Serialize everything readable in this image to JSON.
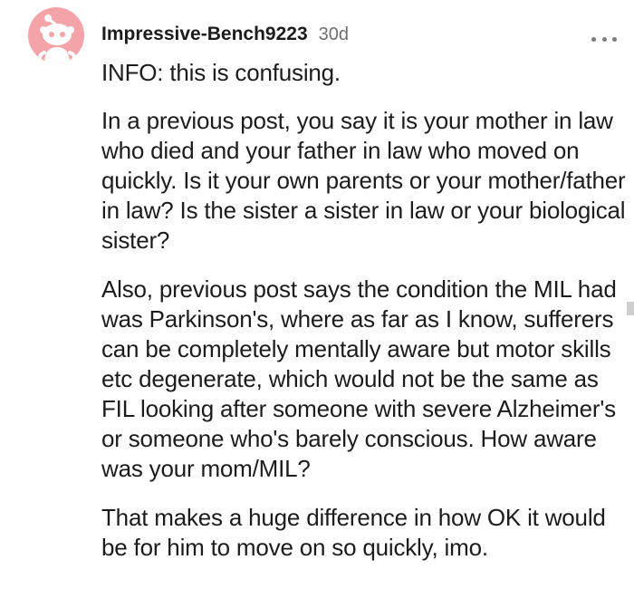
{
  "comment": {
    "author": "Impressive-Bench9223",
    "age": "30d",
    "avatar_icon": "reddit-snoo-icon",
    "avatar_bg": "#f4a3a8",
    "more_icon": "ellipsis-icon",
    "paragraphs": [
      "INFO: this is confusing.",
      "In a previous post, you say it is your mother in law who died and your father in law who moved on quickly. Is it your own parents or your mother/father in law? Is the sister a sister in law or your biological sister?",
      "Also, previous post says the condition the MIL had was Parkinson's, where as far as I know, sufferers can be completely mentally aware but motor skills etc degenerate, which would not be the same as FIL looking after someone with severe Alzheimer's or someone who's barely conscious. How aware was your mom/MIL?",
      "That makes a huge difference in how OK it would be for him to move on so quickly, imo."
    ]
  }
}
